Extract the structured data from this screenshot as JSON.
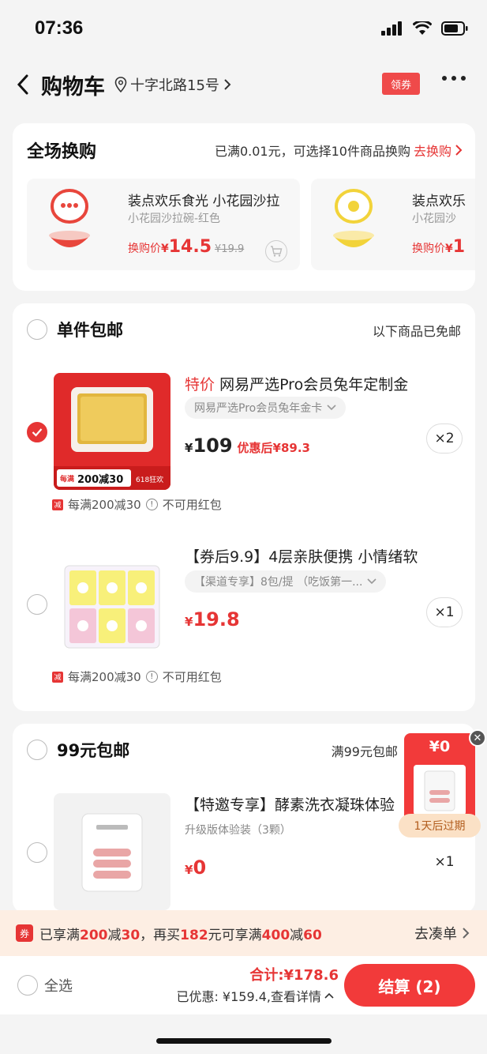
{
  "status": {
    "time": "07:36"
  },
  "nav": {
    "title": "购物车",
    "address": "十字北路15号",
    "coupon_label": "领券"
  },
  "swap": {
    "title": "全场换购",
    "info": "已满0.01元，可选择10件商品换购",
    "link": "去换购",
    "items": [
      {
        "name": "装点欢乐食光 小花园沙拉",
        "sku": "小花园沙拉碗-红色",
        "price_label": "换购价",
        "currency": "¥",
        "price": "14.5",
        "old_price": "¥19.9",
        "color": "#e8463c"
      },
      {
        "name": "装点欢乐",
        "sku": "小花园沙",
        "price_label": "换购价",
        "currency": "¥",
        "price": "1",
        "color": "#f2d33a"
      }
    ]
  },
  "single": {
    "title": "单件包邮",
    "note": "以下商品已免邮",
    "items": [
      {
        "tag": "特价",
        "name": "网易严选Pro会员兔年定制金",
        "sku": "网易严选Pro会员兔年金卡",
        "currency": "¥",
        "price": "109",
        "after_price": "优惠后¥89.3",
        "qty": "×2",
        "promo": "每满200减30",
        "no_redpack": "不可用红包",
        "thumb_badge": "200减30",
        "thumb_badge_prefix": "每满",
        "thumb_event": "618狂欢",
        "checked": true
      },
      {
        "name": "【券后9.9】4层亲肤便携 小情绪软",
        "sku": "【渠道专享】8包/提 （吃饭第一...",
        "currency": "¥",
        "price": "19.8",
        "qty": "×1",
        "promo": "每满200减30",
        "no_redpack": "不可用红包",
        "checked": false
      }
    ]
  },
  "ninety": {
    "title": "99元包邮",
    "note": "满99元包邮",
    "items": [
      {
        "name": "【特邀专享】酵素洗衣凝珠体验",
        "sku": "升级版体验装（3颗）",
        "currency": "¥",
        "price": "0",
        "qty": "×1"
      }
    ]
  },
  "float_coupon": {
    "amount": "¥0",
    "expire": "1天后过期"
  },
  "promo_bar": {
    "badge": "券",
    "prefix": "已享满",
    "a": "200",
    "mid1": "减",
    "b": "30",
    "mid2": "，再买",
    "c": "182",
    "mid3": "元可享满",
    "d": "400",
    "mid4": "减",
    "e": "60",
    "link": "去凑单"
  },
  "bottom": {
    "select_all": "全选",
    "total": "合计:¥178.6",
    "saved": "已优惠: ¥159.4,查看详情",
    "checkout": "结算 (2)"
  },
  "colors": {
    "accent": "#e63535",
    "background": "#f4f4f4"
  }
}
